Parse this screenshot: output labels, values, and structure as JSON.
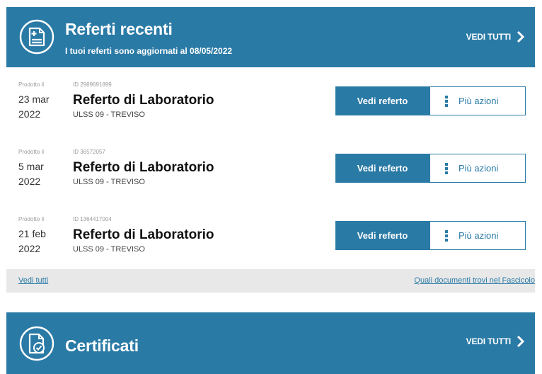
{
  "referti_header": {
    "title": "Referti recenti",
    "subtitle": "I tuoi referti sono aggiornati al 08/05/2022",
    "see_all": "VEDI TUTTI",
    "icon": "medical-document-icon"
  },
  "referti": [
    {
      "produced_label": "Prodotto il",
      "date_line1": "23 mar",
      "date_line2": "2022",
      "id_text": "ID 2989691899",
      "title": "Referto di Laboratorio",
      "org": "ULSS 09 - TREVISO",
      "view_label": "Vedi referto",
      "more_label": "Più azioni"
    },
    {
      "produced_label": "Prodotto il",
      "date_line1": "5 mar",
      "date_line2": "2022",
      "id_text": "ID 36572057",
      "title": "Referto di Laboratorio",
      "org": "ULSS 09 - TREVISO",
      "view_label": "Vedi referto",
      "more_label": "Più azioni"
    },
    {
      "produced_label": "Prodotto il",
      "date_line1": "21 feb",
      "date_line2": "2022",
      "id_text": "ID 1364417004",
      "title": "Referto di Laboratorio",
      "org": "ULSS 09 - TREVISO",
      "view_label": "Vedi referto",
      "more_label": "Più azioni"
    }
  ],
  "footer": {
    "left_link": "Vedi tutti",
    "right_link": "Quali documenti trovi nel Fascicolo"
  },
  "certificati_header": {
    "title": "Certificati",
    "see_all": "VEDI TUTTI",
    "icon": "certificate-icon"
  },
  "colors": {
    "brand": "#2a7aa6",
    "footer_bg": "#e8e8e8"
  }
}
